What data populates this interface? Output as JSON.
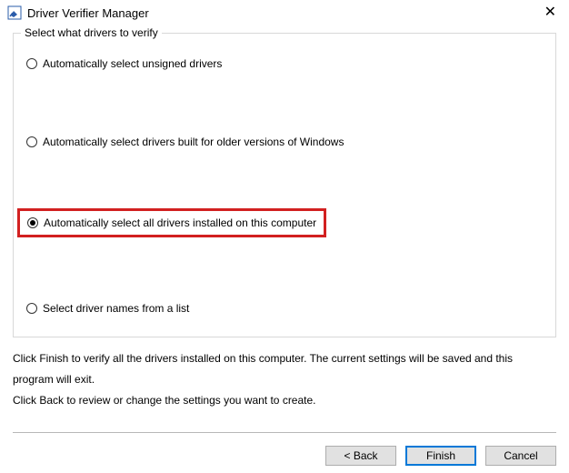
{
  "window": {
    "title": "Driver Verifier Manager"
  },
  "group": {
    "legend": "Select what drivers to verify",
    "options": [
      {
        "label": "Automatically select unsigned drivers",
        "selected": false,
        "highlighted": false
      },
      {
        "label": "Automatically select drivers built for older versions of Windows",
        "selected": false,
        "highlighted": false
      },
      {
        "label": "Automatically select all drivers installed on this computer",
        "selected": true,
        "highlighted": true
      },
      {
        "label": "Select driver names from a list",
        "selected": false,
        "highlighted": false
      }
    ]
  },
  "info": {
    "line1": "Click Finish to verify all the drivers installed on this computer. The current settings will be saved and this program will exit.",
    "line2": "Click Back to review or change the settings you want to create."
  },
  "buttons": {
    "back": "< Back",
    "finish": "Finish",
    "cancel": "Cancel"
  }
}
